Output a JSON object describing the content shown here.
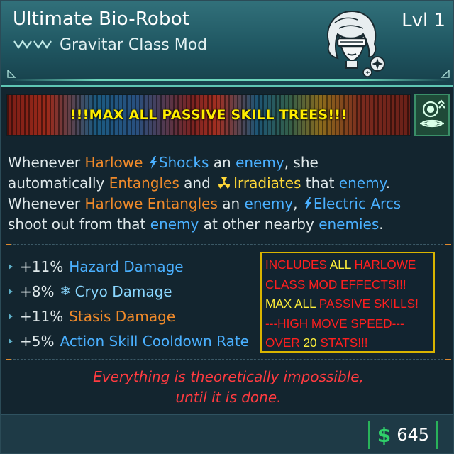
{
  "header": {
    "item_name": "Ultimate Bio-Robot",
    "level": "Lvl 1",
    "item_type": "Gravitar Class Mod",
    "rarity_icon": "chevrons-icon",
    "portrait_icon": "harlowe-portrait-icon"
  },
  "banner": {
    "text": "!!!MAX ALL PASSIVE SKILL TREES!!!",
    "skill_icon": "gravitar-skill-icon"
  },
  "description": {
    "line1": [
      "Whenever ",
      "Harlowe",
      " ",
      "Shocks",
      " an ",
      "enemy",
      ", she"
    ],
    "line2": [
      "automatically ",
      "Entangles",
      " and ",
      "Irradiates",
      " that ",
      "enemy",
      "."
    ],
    "line3": [
      "Whenever ",
      "Harlowe Entangles",
      " an ",
      "enemy",
      ", ",
      "Electric Arcs"
    ],
    "line4": [
      "shoot out from that ",
      "enemy",
      " at other nearby ",
      "enemies",
      "."
    ]
  },
  "stats": [
    {
      "value": "+11%",
      "label": "Hazard Damage",
      "color": "#4ab0ff",
      "icon": ""
    },
    {
      "value": "+8%",
      "label": "Cryo Damage",
      "color": "#8ad7ff",
      "icon": "snowflake-icon"
    },
    {
      "value": "+11%",
      "label": "Stasis Damage",
      "color": "#f08a2a",
      "icon": ""
    },
    {
      "value": "+5%",
      "label": "Action Skill Cooldown Rate",
      "color": "#4ab0ff",
      "icon": ""
    }
  ],
  "promo": {
    "l1a": "INCLUDES ",
    "l1b": "ALL",
    "l1c": " HARLOWE",
    "l2": "CLASS MOD EFFECTS!!!",
    "l3a": "MAX ALL",
    "l3b": " PASSIVE SKILLS!",
    "l4": "---HIGH MOVE SPEED---",
    "l5a": "OVER ",
    "l5b": "20",
    "l5c": " STATS!!!"
  },
  "quote": {
    "line1": "Everything is theoretically impossible,",
    "line2": "until it is done."
  },
  "footer": {
    "currency_symbol": "$",
    "price": "645"
  },
  "colors": {
    "accent_teal": "#5fc6b4",
    "element_orange": "#f08a2a",
    "element_blue": "#4ab0ff",
    "irradiate_yellow": "#ffd838",
    "promo_red": "#ff1f1f",
    "banner_yellow": "#ffee00",
    "money_green": "#2fd06a"
  }
}
